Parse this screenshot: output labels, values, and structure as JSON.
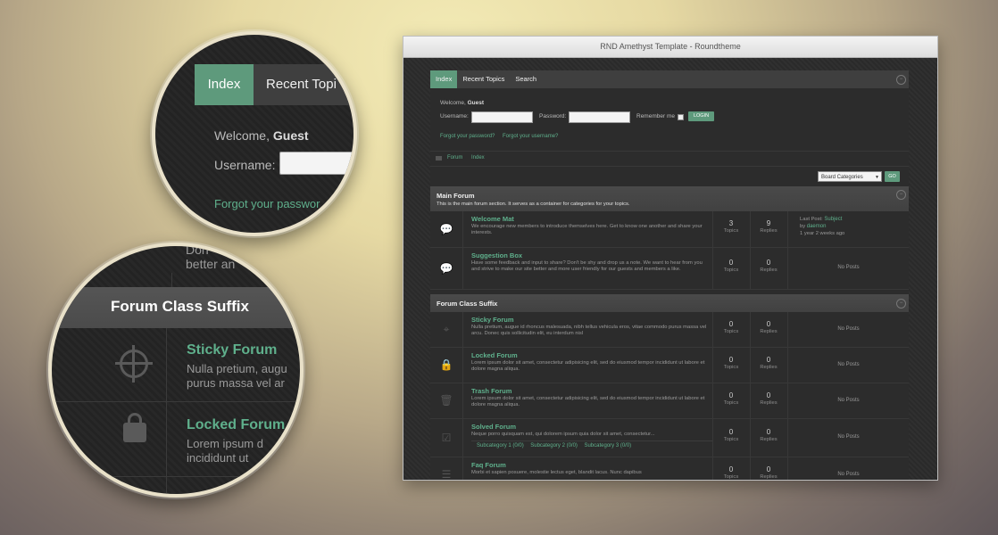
{
  "window": {
    "title": "RND Amethyst Template - Roundtheme"
  },
  "nav": {
    "tabs": [
      {
        "label": "Index"
      },
      {
        "label": "Recent Topics"
      },
      {
        "label": "Search"
      }
    ]
  },
  "login": {
    "welcome": "Welcome,",
    "user": "Guest",
    "username_label": "Username:",
    "password_label": "Password:",
    "remember_label": "Remember me",
    "login_button": "LOGIN",
    "forgot_password": "Forgot your password?",
    "forgot_username": "Forgot your username?"
  },
  "breadcrumb": {
    "items": [
      "Forum",
      "Index"
    ]
  },
  "jump": {
    "select": "Board Categories",
    "go": "GO"
  },
  "main_forum": {
    "title": "Main Forum",
    "description": "This is the main forum section. It serves as a container for categories for your topics.",
    "rows": [
      {
        "title": "Welcome Mat",
        "desc": "We encourage new members to introduce themselves here. Get to know one another and share your interests.",
        "topics": "3",
        "replies": "9",
        "last_label": "Last Post:",
        "last_subject": "Subject",
        "last_by": "by",
        "last_user": "daemon",
        "last_time": "1 year 2 weeks ago"
      },
      {
        "title": "Suggestion Box",
        "desc": "Have some feedback and input to share? Don't be shy and drop us a note. We want to hear from you and strive to make our site better and more user friendly for our guests and members a like.",
        "topics": "0",
        "replies": "0",
        "no_posts": "No Posts"
      }
    ]
  },
  "class_forum": {
    "title": "Forum Class Suffix",
    "rows": [
      {
        "title": "Sticky Forum",
        "desc": "Nulla pretium, augue id rhoncus malesuada, nibh tellus vehicula eros, vitae commodo purus massa vel arcu. Donec quis sollicitudin elit, eu interdum nisl",
        "topics": "0",
        "replies": "0",
        "no_posts": "No Posts"
      },
      {
        "title": "Locked Forum",
        "desc": "Lorem ipsum dolor sit amet, consectetur adipisicing elit, sed do eiusmod tempor incididunt ut labore et dolore magna aliqua.",
        "topics": "0",
        "replies": "0",
        "no_posts": "No Posts"
      },
      {
        "title": "Trash Forum",
        "desc": "Lorem ipsum dolor sit amet, consectetur adipisicing elit, sed do eiusmod tempor incididunt ut labore et dolore magna aliqua.",
        "topics": "0",
        "replies": "0",
        "no_posts": "No Posts"
      },
      {
        "title": "Solved Forum",
        "desc": "Neque porro quisquam est, qui dolorem ipsum quia dolor sit amet, consectetur...",
        "subcats": [
          "Subcategory 1 (0/0)",
          "Subcategory 2 (0/0)",
          "Subcategory 3 (0/0)"
        ],
        "topics": "0",
        "replies": "0",
        "no_posts": "No Posts"
      },
      {
        "title": "Faq Forum",
        "desc": "Morbi et sapien posuere, molestie lectus eget, blandit lacus. Nunc dapibus",
        "topics": "0",
        "replies": "0",
        "no_posts": "No Posts"
      }
    ]
  },
  "labels": {
    "topics": "Topics",
    "replies": "Replies"
  },
  "zoom1": {
    "tab_active": "Index",
    "tab_next": "Recent Topi",
    "welcome": "Welcome,",
    "user": "Guest",
    "username": "Username:",
    "forgot": "Forgot your passwor"
  },
  "zoom2": {
    "top_text_1": "Don",
    "top_text_2": "better an",
    "header": "Forum Class Suffix",
    "r1_title": "Sticky Forum",
    "r1_l1": "Nulla pretium, augu",
    "r1_l2": "purus massa vel ar",
    "r2_title": "Locked Forum",
    "r2_l1": "Lorem ipsum d",
    "r2_l2": "incididunt ut"
  },
  "colors": {
    "accent": "#5e9a7c",
    "link": "#5fb08c"
  }
}
